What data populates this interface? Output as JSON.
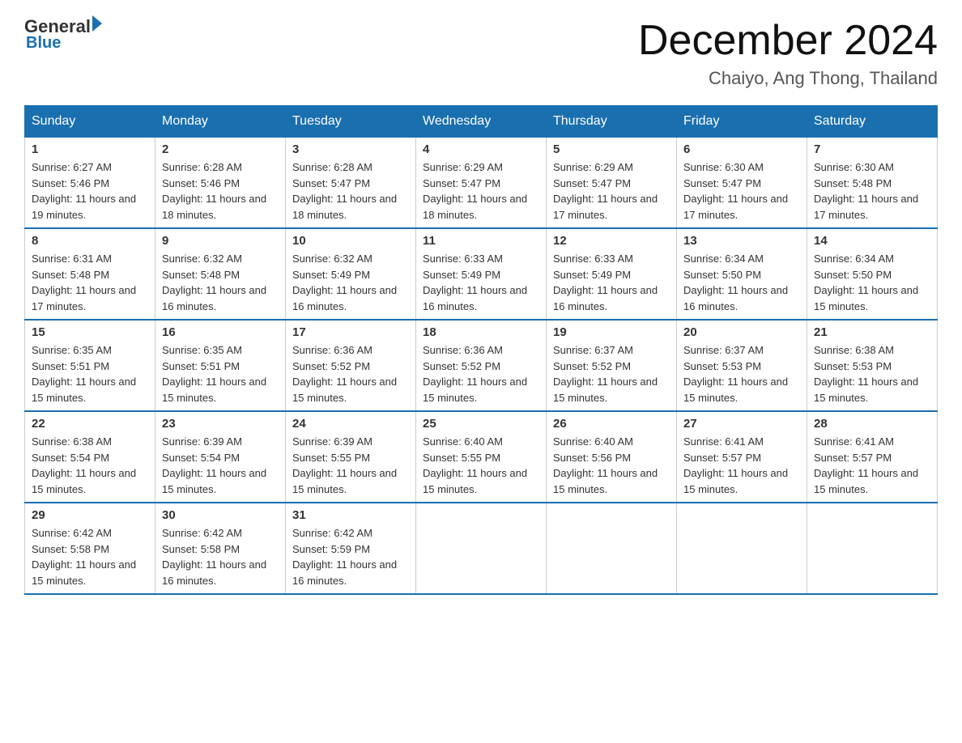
{
  "header": {
    "logo": {
      "part1": "General",
      "arrow": "▶",
      "part2": "Blue"
    },
    "title": "December 2024",
    "location": "Chaiyo, Ang Thong, Thailand"
  },
  "days_of_week": [
    "Sunday",
    "Monday",
    "Tuesday",
    "Wednesday",
    "Thursday",
    "Friday",
    "Saturday"
  ],
  "weeks": [
    [
      {
        "day": "1",
        "sunrise": "6:27 AM",
        "sunset": "5:46 PM",
        "daylight": "11 hours and 19 minutes."
      },
      {
        "day": "2",
        "sunrise": "6:28 AM",
        "sunset": "5:46 PM",
        "daylight": "11 hours and 18 minutes."
      },
      {
        "day": "3",
        "sunrise": "6:28 AM",
        "sunset": "5:47 PM",
        "daylight": "11 hours and 18 minutes."
      },
      {
        "day": "4",
        "sunrise": "6:29 AM",
        "sunset": "5:47 PM",
        "daylight": "11 hours and 18 minutes."
      },
      {
        "day": "5",
        "sunrise": "6:29 AM",
        "sunset": "5:47 PM",
        "daylight": "11 hours and 17 minutes."
      },
      {
        "day": "6",
        "sunrise": "6:30 AM",
        "sunset": "5:47 PM",
        "daylight": "11 hours and 17 minutes."
      },
      {
        "day": "7",
        "sunrise": "6:30 AM",
        "sunset": "5:48 PM",
        "daylight": "11 hours and 17 minutes."
      }
    ],
    [
      {
        "day": "8",
        "sunrise": "6:31 AM",
        "sunset": "5:48 PM",
        "daylight": "11 hours and 17 minutes."
      },
      {
        "day": "9",
        "sunrise": "6:32 AM",
        "sunset": "5:48 PM",
        "daylight": "11 hours and 16 minutes."
      },
      {
        "day": "10",
        "sunrise": "6:32 AM",
        "sunset": "5:49 PM",
        "daylight": "11 hours and 16 minutes."
      },
      {
        "day": "11",
        "sunrise": "6:33 AM",
        "sunset": "5:49 PM",
        "daylight": "11 hours and 16 minutes."
      },
      {
        "day": "12",
        "sunrise": "6:33 AM",
        "sunset": "5:49 PM",
        "daylight": "11 hours and 16 minutes."
      },
      {
        "day": "13",
        "sunrise": "6:34 AM",
        "sunset": "5:50 PM",
        "daylight": "11 hours and 16 minutes."
      },
      {
        "day": "14",
        "sunrise": "6:34 AM",
        "sunset": "5:50 PM",
        "daylight": "11 hours and 15 minutes."
      }
    ],
    [
      {
        "day": "15",
        "sunrise": "6:35 AM",
        "sunset": "5:51 PM",
        "daylight": "11 hours and 15 minutes."
      },
      {
        "day": "16",
        "sunrise": "6:35 AM",
        "sunset": "5:51 PM",
        "daylight": "11 hours and 15 minutes."
      },
      {
        "day": "17",
        "sunrise": "6:36 AM",
        "sunset": "5:52 PM",
        "daylight": "11 hours and 15 minutes."
      },
      {
        "day": "18",
        "sunrise": "6:36 AM",
        "sunset": "5:52 PM",
        "daylight": "11 hours and 15 minutes."
      },
      {
        "day": "19",
        "sunrise": "6:37 AM",
        "sunset": "5:52 PM",
        "daylight": "11 hours and 15 minutes."
      },
      {
        "day": "20",
        "sunrise": "6:37 AM",
        "sunset": "5:53 PM",
        "daylight": "11 hours and 15 minutes."
      },
      {
        "day": "21",
        "sunrise": "6:38 AM",
        "sunset": "5:53 PM",
        "daylight": "11 hours and 15 minutes."
      }
    ],
    [
      {
        "day": "22",
        "sunrise": "6:38 AM",
        "sunset": "5:54 PM",
        "daylight": "11 hours and 15 minutes."
      },
      {
        "day": "23",
        "sunrise": "6:39 AM",
        "sunset": "5:54 PM",
        "daylight": "11 hours and 15 minutes."
      },
      {
        "day": "24",
        "sunrise": "6:39 AM",
        "sunset": "5:55 PM",
        "daylight": "11 hours and 15 minutes."
      },
      {
        "day": "25",
        "sunrise": "6:40 AM",
        "sunset": "5:55 PM",
        "daylight": "11 hours and 15 minutes."
      },
      {
        "day": "26",
        "sunrise": "6:40 AM",
        "sunset": "5:56 PM",
        "daylight": "11 hours and 15 minutes."
      },
      {
        "day": "27",
        "sunrise": "6:41 AM",
        "sunset": "5:57 PM",
        "daylight": "11 hours and 15 minutes."
      },
      {
        "day": "28",
        "sunrise": "6:41 AM",
        "sunset": "5:57 PM",
        "daylight": "11 hours and 15 minutes."
      }
    ],
    [
      {
        "day": "29",
        "sunrise": "6:42 AM",
        "sunset": "5:58 PM",
        "daylight": "11 hours and 15 minutes."
      },
      {
        "day": "30",
        "sunrise": "6:42 AM",
        "sunset": "5:58 PM",
        "daylight": "11 hours and 16 minutes."
      },
      {
        "day": "31",
        "sunrise": "6:42 AM",
        "sunset": "5:59 PM",
        "daylight": "11 hours and 16 minutes."
      },
      null,
      null,
      null,
      null
    ]
  ],
  "colors": {
    "header_bg": "#1a6faf",
    "border": "#1a6faf",
    "logo_blue": "#1a6faf"
  }
}
